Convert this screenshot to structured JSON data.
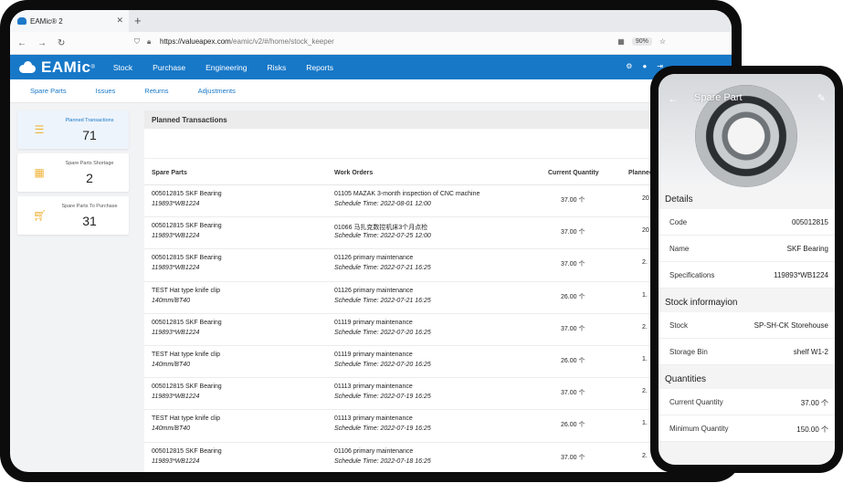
{
  "browser": {
    "tab_title": "EAMic® 2",
    "new_tab": "+",
    "url_host": "https://valueapex.com",
    "url_path": "/eamic/v2/#/home/stock_keeper",
    "zoom": "90%"
  },
  "app": {
    "brand": "EAMic",
    "brand_mark": "®",
    "menu": [
      "Stock",
      "Purchase",
      "Engineering",
      "Risks",
      "Reports"
    ],
    "subnav": [
      "Spare Parts",
      "Issues",
      "Returns",
      "Adjustments"
    ]
  },
  "sidebar": {
    "cards": [
      {
        "label": "Planned Transactions",
        "count": "71",
        "icon": "list-icon"
      },
      {
        "label": "Spare Parts Shortage",
        "count": "2",
        "icon": "calculator-icon"
      },
      {
        "label": "Spare Parts To Purchase",
        "count": "31",
        "icon": "cart-icon"
      }
    ]
  },
  "table": {
    "title": "Planned Transactions",
    "columns": [
      "Spare Parts",
      "Work Orders",
      "Current Quantity",
      "Planned"
    ],
    "rows": [
      {
        "part": "005012815 SKF Bearing",
        "spec": "119893*WB1224",
        "wo": "01105 MAZAK 3-month inspection of CNC machine",
        "sched": "Schedule Time: 2022-08-01 12:00",
        "qty": "37.00 个",
        "planned": "20"
      },
      {
        "part": "005012815 SKF Bearing",
        "spec": "119893*WB1224",
        "wo": "01066 马扎克数控机床3个月点检",
        "sched": "Schedule Time: 2022-07-25 12:00",
        "qty": "37.00 个",
        "planned": "20"
      },
      {
        "part": "005012815 SKF Bearing",
        "spec": "119893*WB1224",
        "wo": "01126 primary maintenance",
        "sched": "Schedule Time: 2022-07-21 16:25",
        "qty": "37.00 个",
        "planned": "2."
      },
      {
        "part": "TEST Hat type knife clip",
        "spec": "140mm/BT40",
        "wo": "01126 primary maintenance",
        "sched": "Schedule Time: 2022-07-21 16:25",
        "qty": "26.00 个",
        "planned": "1."
      },
      {
        "part": "005012815 SKF Bearing",
        "spec": "119893*WB1224",
        "wo": "01119 primary maintenance",
        "sched": "Schedule Time: 2022-07-20 16:25",
        "qty": "37.00 个",
        "planned": "2."
      },
      {
        "part": "TEST Hat type knife clip",
        "spec": "140mm/BT40",
        "wo": "01119 primary maintenance",
        "sched": "Schedule Time: 2022-07-20 16:25",
        "qty": "26.00 个",
        "planned": "1."
      },
      {
        "part": "005012815 SKF Bearing",
        "spec": "119893*WB1224",
        "wo": "01113 primary maintenance",
        "sched": "Schedule Time: 2022-07-19 16:25",
        "qty": "37.00 个",
        "planned": "2."
      },
      {
        "part": "TEST Hat type knife clip",
        "spec": "140mm/BT40",
        "wo": "01113 primary maintenance",
        "sched": "Schedule Time: 2022-07-19 16:25",
        "qty": "26.00 个",
        "planned": "1."
      },
      {
        "part": "005012815 SKF Bearing",
        "spec": "119893*WB1224",
        "wo": "01106 primary maintenance",
        "sched": "Schedule Time: 2022-07-18 16:25",
        "qty": "37.00 个",
        "planned": "2."
      }
    ]
  },
  "phone": {
    "title": "Spare Part",
    "sections": [
      {
        "title": "Details",
        "items": [
          {
            "k": "Code",
            "v": "005012815"
          },
          {
            "k": "Name",
            "v": "SKF Bearing"
          },
          {
            "k": "Specifications",
            "v": "119893*WB1224"
          }
        ]
      },
      {
        "title": "Stock informayion",
        "items": [
          {
            "k": "Stock",
            "v": "SP-SH-CK Storehouse"
          },
          {
            "k": "Storage Bin",
            "v": "shelf W1-2"
          }
        ]
      },
      {
        "title": "Quantities",
        "items": [
          {
            "k": "Current Quantity",
            "v": "37.00 个"
          },
          {
            "k": "Minimum Quantity",
            "v": "150.00 个"
          }
        ]
      }
    ]
  }
}
